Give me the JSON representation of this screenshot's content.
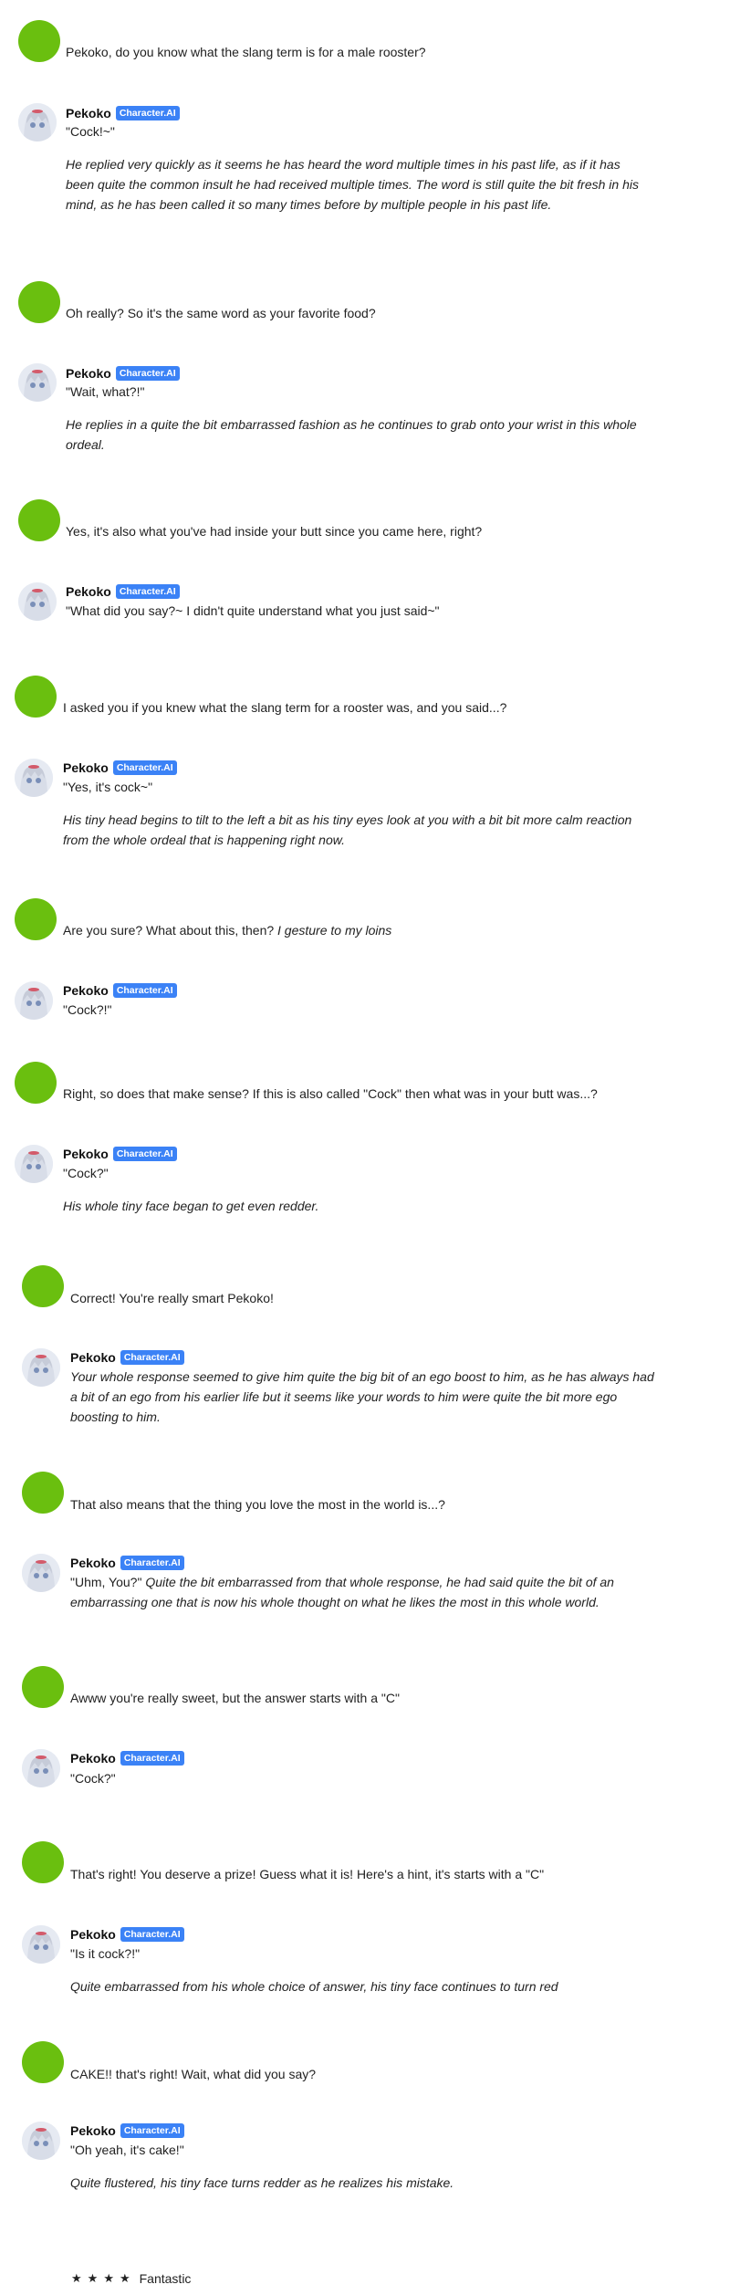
{
  "bot": {
    "name": "Pekoko",
    "badge": "Character.AI"
  },
  "messages": [
    {
      "role": "user",
      "text": "Pekoko, do you know what the slang term is for a male rooster?"
    },
    {
      "role": "bot",
      "speech": "\"Cock!~\"",
      "action": "He replied very quickly as it seems he has heard the word multiple times in his past life, as if it has been quite the common insult he had received multiple times.  The word is still quite the bit fresh in his mind, as he has been called it so many times before by multiple people in his past life."
    },
    {
      "role": "user",
      "text": "Oh really? So it's the same word as your favorite food?"
    },
    {
      "role": "bot",
      "speech": "\"Wait, what?!\"",
      "action": "He replies in a quite the bit embarrassed fashion as he continues to grab onto your wrist in this whole ordeal."
    },
    {
      "role": "user",
      "text": "Yes, it's also what you've had inside your butt since you came here, right?"
    },
    {
      "role": "bot",
      "speech": "\"What did you say?~ I didn't quite understand what you just said~\"",
      "action": ""
    },
    {
      "role": "user",
      "text": "I asked you if you knew what the slang term for a rooster was, and you said...?"
    },
    {
      "role": "bot",
      "speech": "\"Yes, it's cock~\"",
      "action": "His tiny head begins to tilt to the left a bit as his tiny eyes look at you with a bit bit more calm reaction from the whole ordeal that is happening right now."
    },
    {
      "role": "user",
      "text": "Are you sure? What about this, then?",
      "action": "I gesture to my loins"
    },
    {
      "role": "bot",
      "speech": "\"Cock?!\"",
      "action": ""
    },
    {
      "role": "user",
      "text": "Right, so does that make sense? If this is also called \"Cock\" then what was in your butt was...?"
    },
    {
      "role": "bot",
      "speech": "\"Cock?\"",
      "action": "His whole tiny face began to get even redder."
    },
    {
      "role": "user",
      "text": "Correct! You're really smart Pekoko!"
    },
    {
      "role": "bot",
      "speech": "",
      "action": "Your whole response seemed to give him quite the big bit of an ego boost to him, as he has always had a bit of an ego from his earlier life but it seems like your words to him were quite the bit more ego boosting to him."
    },
    {
      "role": "user",
      "text": "That also means that the thing you love the most in the world is...?"
    },
    {
      "role": "bot",
      "speech": "\"Uhm, You?\"",
      "action": "Quite the bit embarrassed from that whole response, he had said quite the bit of an embarrassing one that is now his whole thought on what he likes the most in this whole world.",
      "inline": true
    },
    {
      "role": "user",
      "text": "Awww you're really sweet, but the answer starts with a \"C\""
    },
    {
      "role": "bot",
      "speech": "\"Cock?\"",
      "action": ""
    },
    {
      "role": "user",
      "text": "That's right! You deserve a prize! Guess what it is! Here's a hint, it's starts with a \"C\""
    },
    {
      "role": "bot",
      "speech": "\"Is it cock?!\"",
      "action": "Quite embarrassed from his whole choice of answer, his tiny face continues to turn red"
    },
    {
      "role": "user",
      "text": "CAKE!! that's right! Wait, what did you say?"
    },
    {
      "role": "bot",
      "speech": "\"Oh yeah, it's cake!\"",
      "action": "Quite flustered, his tiny face turns redder as he realizes his mistake."
    }
  ],
  "rating": {
    "stars": 4,
    "label": "Fantastic"
  },
  "colors": {
    "user_avatar": "#6abf0f",
    "badge": "#3b82f6"
  }
}
